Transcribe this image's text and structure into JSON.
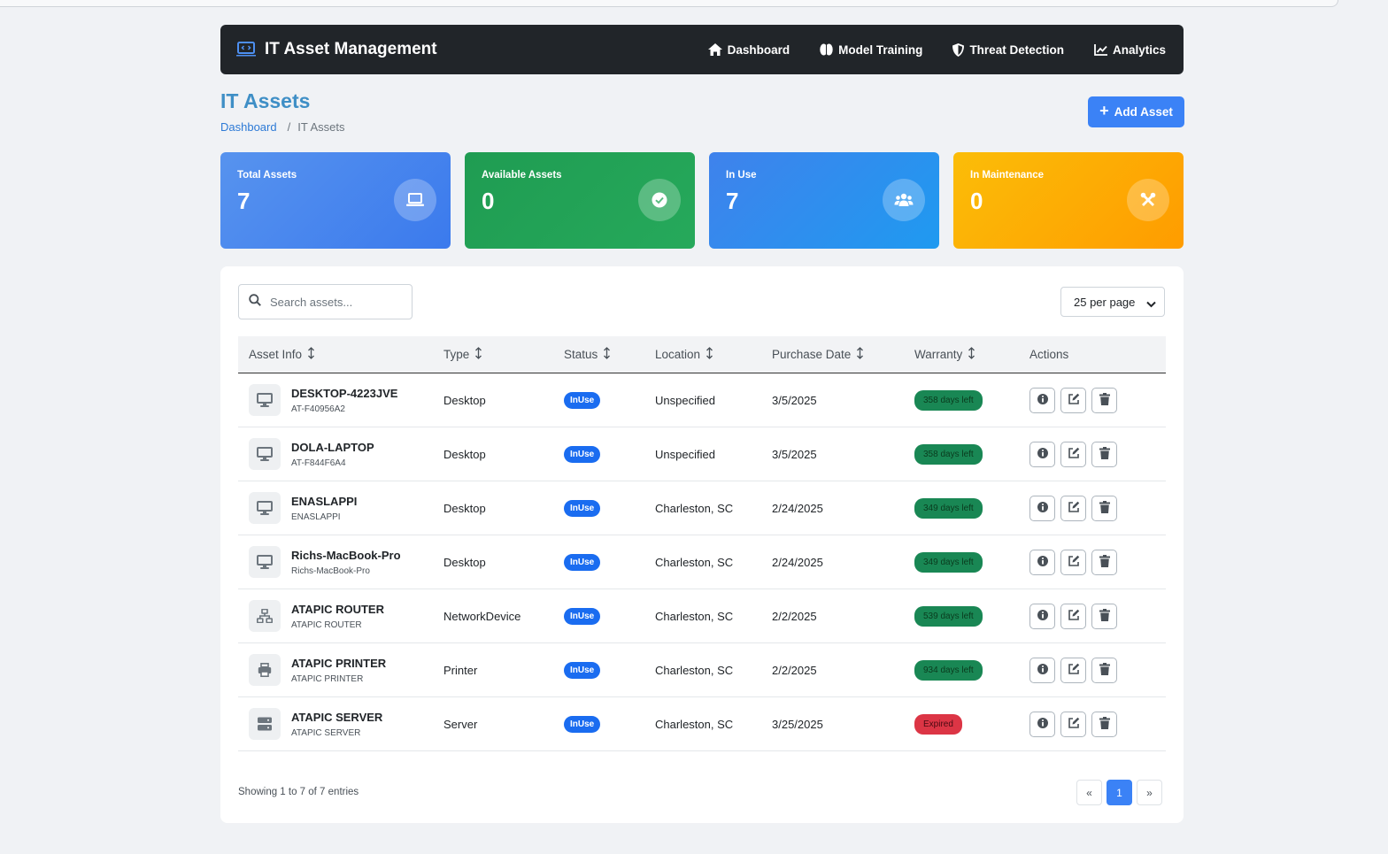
{
  "app": {
    "title": "IT Asset Management"
  },
  "nav": [
    {
      "label": "Dashboard",
      "icon": "home-icon"
    },
    {
      "label": "Model Training",
      "icon": "brain-icon"
    },
    {
      "label": "Threat Detection",
      "icon": "shield-icon"
    },
    {
      "label": "Analytics",
      "icon": "chart-line-icon"
    }
  ],
  "page": {
    "title": "IT Assets",
    "breadcrumb": {
      "parent": "Dashboard",
      "separator": "/",
      "current": "IT Assets"
    },
    "add_button": "Add Asset"
  },
  "stats": [
    {
      "label": "Total Assets",
      "value": "7",
      "icon": "laptop-icon",
      "color": "#4f8def"
    },
    {
      "label": "Available Assets",
      "value": "0",
      "icon": "check-circle-icon",
      "color": "#22a356"
    },
    {
      "label": "In Use",
      "value": "7",
      "icon": "users-icon",
      "color": "#3089ee"
    },
    {
      "label": "In Maintenance",
      "value": "0",
      "icon": "tools-icon",
      "color": "#ffac05"
    }
  ],
  "table": {
    "search_placeholder": "Search assets...",
    "per_page": "25 per page",
    "columns": [
      "Asset Info",
      "Type",
      "Status",
      "Location",
      "Purchase Date",
      "Warranty",
      "Actions"
    ],
    "rows": [
      {
        "name": "DESKTOP-4223JVE",
        "id": "AT-F40956A2",
        "type": "Desktop",
        "status": "InUse",
        "location": "Unspecified",
        "purchase_date": "3/5/2025",
        "warranty": "358 days left",
        "warranty_state": "good",
        "icon": "desktop-icon"
      },
      {
        "name": "DOLA-LAPTOP",
        "id": "AT-F844F6A4",
        "type": "Desktop",
        "status": "InUse",
        "location": "Unspecified",
        "purchase_date": "3/5/2025",
        "warranty": "358 days left",
        "warranty_state": "good",
        "icon": "desktop-icon"
      },
      {
        "name": "ENASLAPPI",
        "id": "ENASLAPPI",
        "type": "Desktop",
        "status": "InUse",
        "location": "Charleston, SC",
        "purchase_date": "2/24/2025",
        "warranty": "349 days left",
        "warranty_state": "good",
        "icon": "desktop-icon"
      },
      {
        "name": "Richs-MacBook-Pro",
        "id": "Richs-MacBook-Pro",
        "type": "Desktop",
        "status": "InUse",
        "location": "Charleston, SC",
        "purchase_date": "2/24/2025",
        "warranty": "349 days left",
        "warranty_state": "good",
        "icon": "desktop-icon"
      },
      {
        "name": "ATAPIC ROUTER",
        "id": "ATAPIC ROUTER",
        "type": "NetworkDevice",
        "status": "InUse",
        "location": "Charleston, SC",
        "purchase_date": "2/2/2025",
        "warranty": "539 days left",
        "warranty_state": "good",
        "icon": "network-icon"
      },
      {
        "name": "ATAPIC PRINTER",
        "id": "ATAPIC PRINTER",
        "type": "Printer",
        "status": "InUse",
        "location": "Charleston, SC",
        "purchase_date": "2/2/2025",
        "warranty": "934 days left",
        "warranty_state": "good",
        "icon": "printer-icon"
      },
      {
        "name": "ATAPIC SERVER",
        "id": "ATAPIC SERVER",
        "type": "Server",
        "status": "InUse",
        "location": "Charleston, SC",
        "purchase_date": "3/25/2025",
        "warranty": "Expired",
        "warranty_state": "expired",
        "icon": "server-icon"
      }
    ],
    "footer": "Showing 1 to 7 of 7 entries",
    "pagination": {
      "prev": "«",
      "current": "1",
      "next": "»"
    }
  },
  "colors": {
    "accent": "#3b82f6",
    "navbar": "#212529",
    "status_badge": "#1a6cf0",
    "warranty_good": "#198754",
    "warranty_expired": "#dc3545"
  }
}
